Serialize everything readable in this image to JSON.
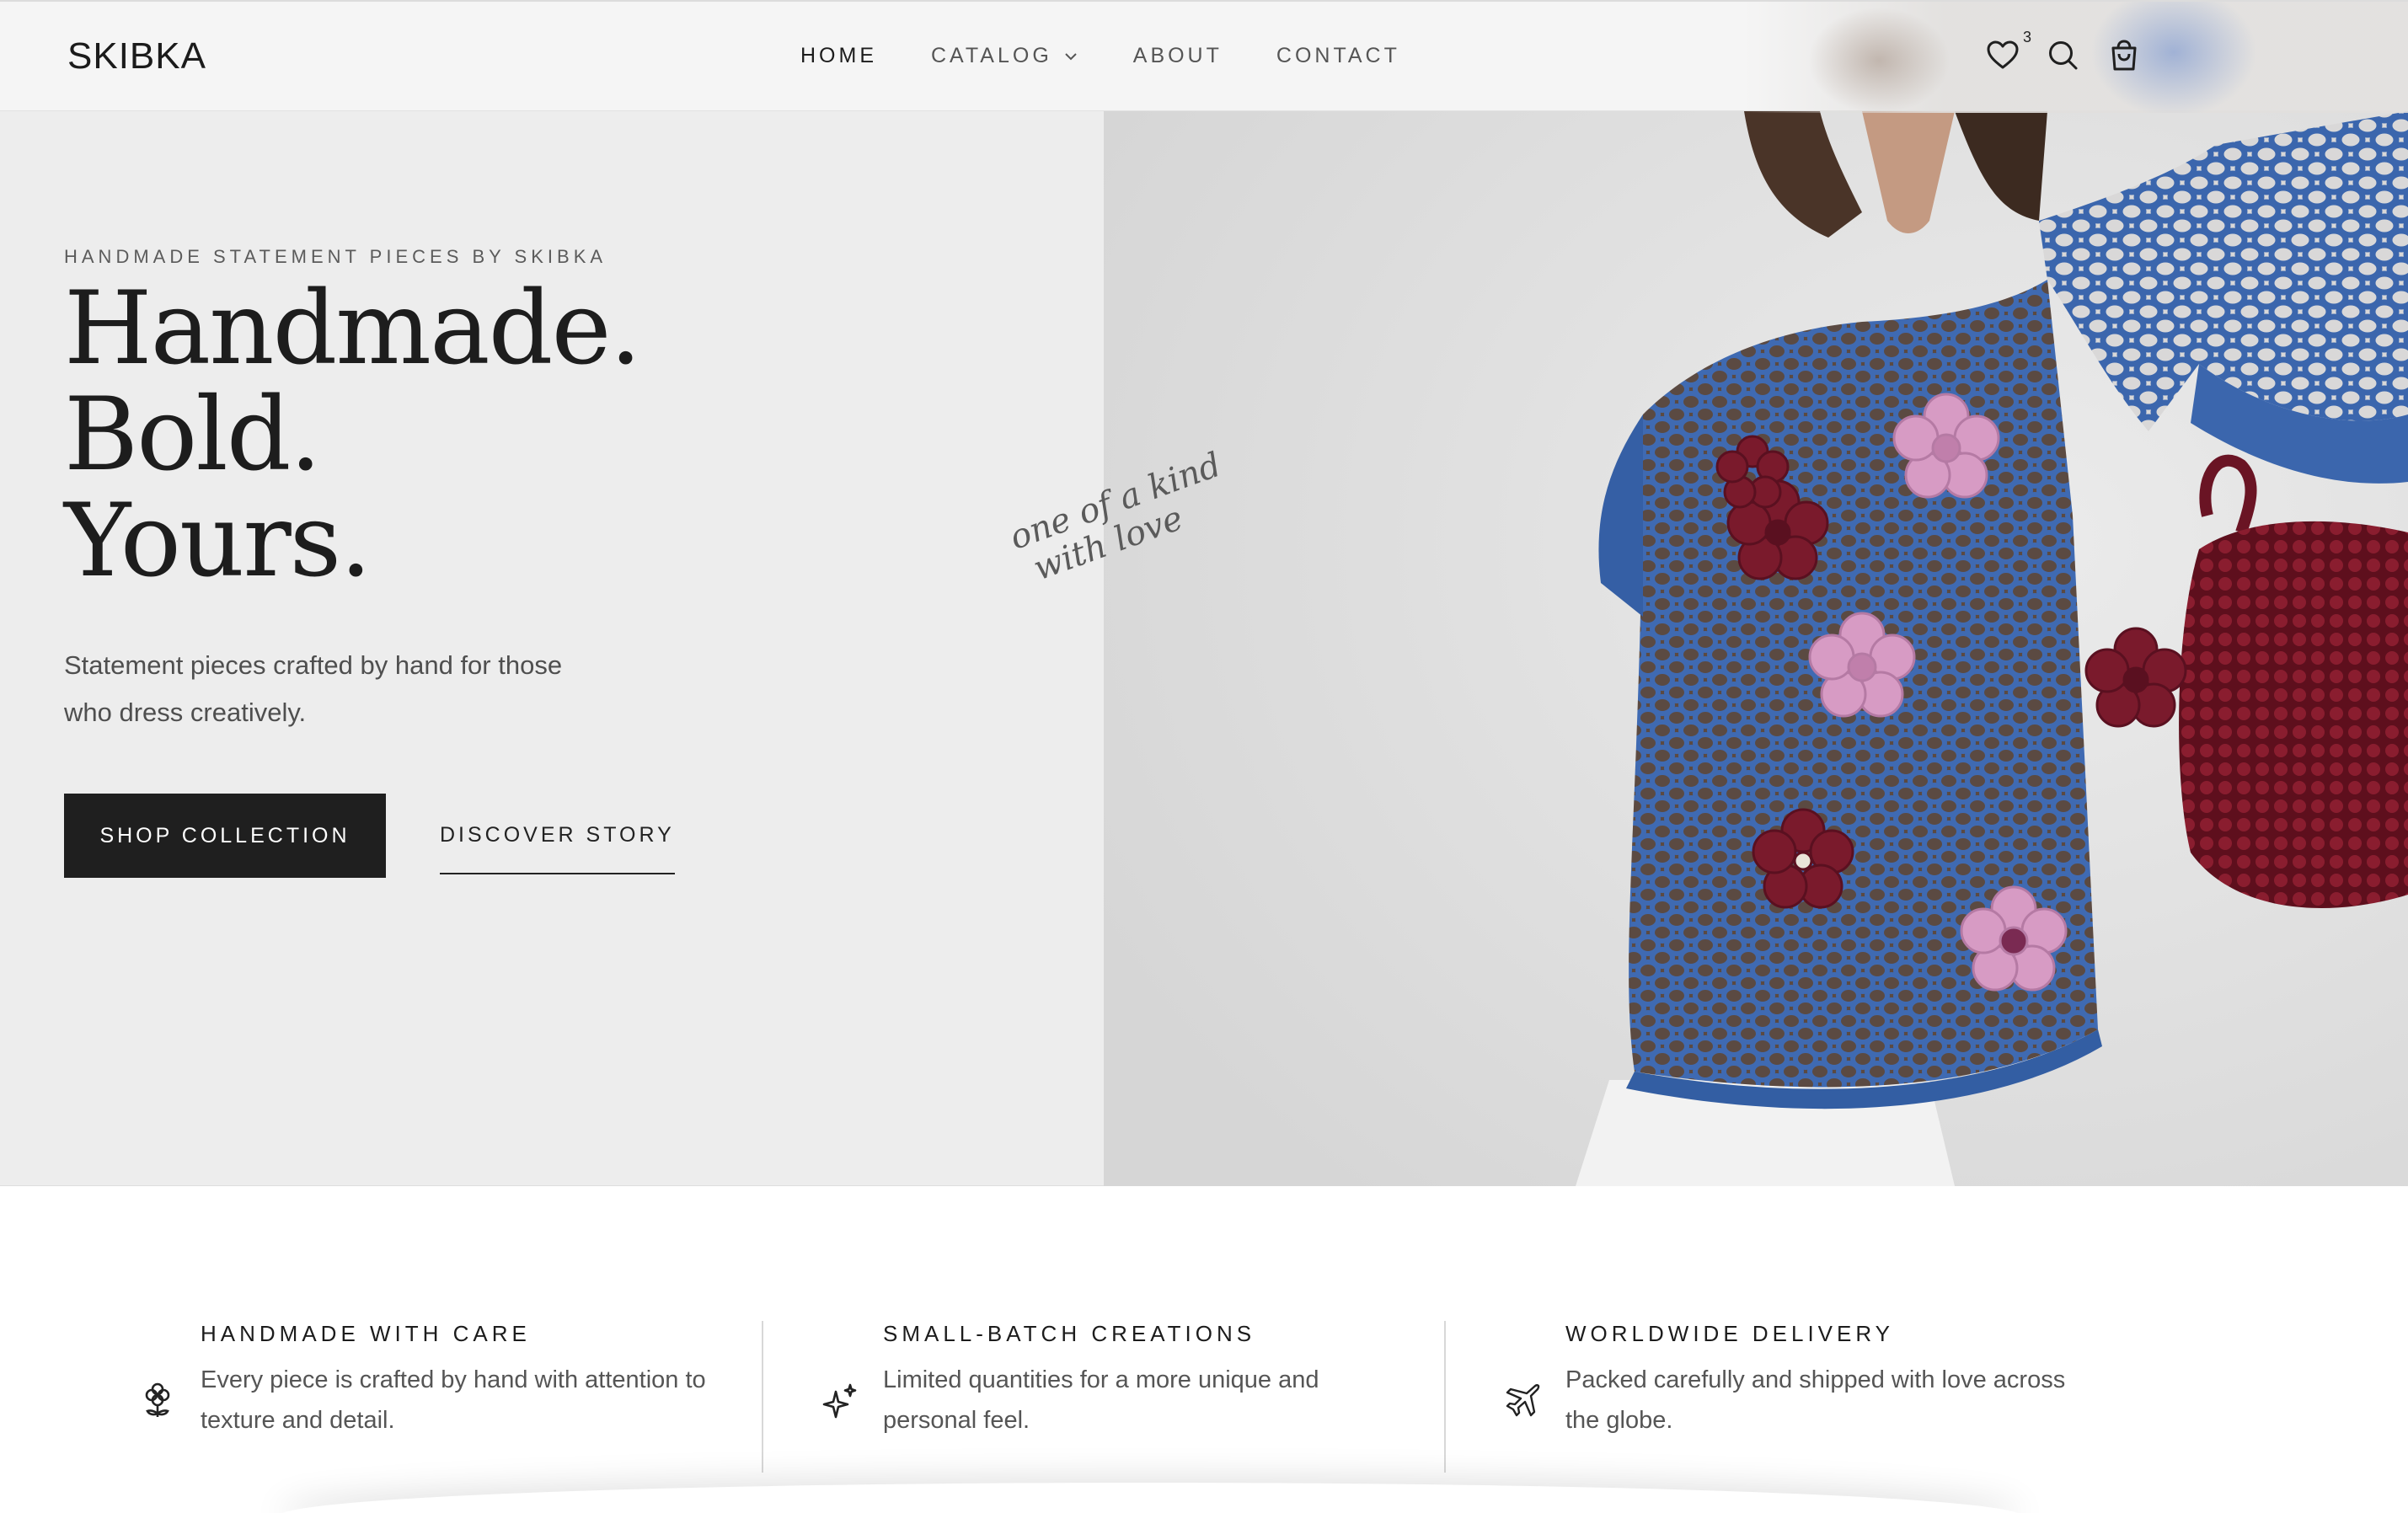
{
  "brand": {
    "logo": "SKIBKA"
  },
  "nav": {
    "items": [
      {
        "label": "HOME",
        "active": true
      },
      {
        "label": "CATALOG",
        "has_dropdown": true
      },
      {
        "label": "ABOUT"
      },
      {
        "label": "CONTACT"
      }
    ]
  },
  "header_icons": {
    "wishlist": {
      "icon": "heart-icon",
      "count": "3"
    },
    "search": {
      "icon": "search-icon"
    },
    "cart": {
      "icon": "shopping-bag-icon"
    }
  },
  "hero": {
    "eyebrow": "HANDMADE STATEMENT PIECES BY SKIBKA",
    "headline": [
      "Handmade.",
      "Bold.",
      "Yours."
    ],
    "subcopy": "Statement pieces crafted by hand for those who dress creatively.",
    "primary_cta": "SHOP COLLECTION",
    "secondary_cta": "DISCOVER STORY",
    "script_note": [
      "one of a kind",
      "with love"
    ],
    "image": "model wearing blue crochet top with pink and burgundy flowers"
  },
  "features": [
    {
      "icon": "flower-icon",
      "title": "HANDMADE WITH CARE",
      "text": "Every piece is crafted by hand with attention to texture and detail."
    },
    {
      "icon": "sparkle-icon",
      "title": "SMALL-BATCH CREATIONS",
      "text": "Limited quantities for a more unique and personal feel."
    },
    {
      "icon": "airplane-icon",
      "title": "WORLDWIDE DELIVERY",
      "text": "Packed carefully and shipped with love across the globe."
    }
  ],
  "colors": {
    "hero_bg": "#ededed",
    "primary_button": "#1f1f1f",
    "sweater_blue": "#3d67ad",
    "flower_pink": "#d79bc4",
    "flower_burgundy": "#7a1a2c"
  }
}
